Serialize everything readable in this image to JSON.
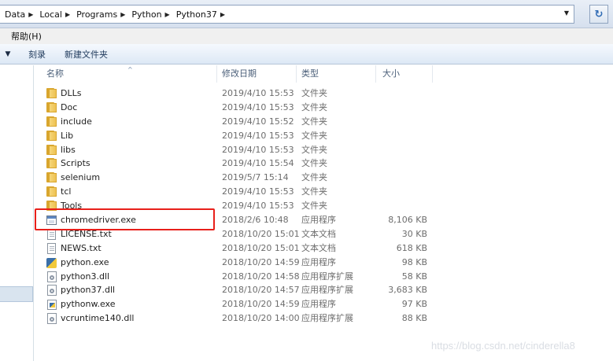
{
  "address_bar": {
    "breadcrumbs": [
      "Data",
      "Local",
      "Programs",
      "Python",
      "Python37"
    ],
    "separator_icon": "chevron-right-icon",
    "dropdown_icon": "chevron-down-icon",
    "refresh_icon": "refresh-icon"
  },
  "menu": {
    "items": [
      "帮助(H)"
    ]
  },
  "toolbar": {
    "dropdown_icon": "chevron-down-icon",
    "buttons": [
      "刻录",
      "新建文件夹"
    ]
  },
  "columns": [
    "名称",
    "修改日期",
    "类型",
    "大小"
  ],
  "files": [
    {
      "name": "DLLs",
      "date": "2019/4/10 15:53",
      "type": "文件夹",
      "size": "",
      "icon": "folder-icon"
    },
    {
      "name": "Doc",
      "date": "2019/4/10 15:53",
      "type": "文件夹",
      "size": "",
      "icon": "folder-icon"
    },
    {
      "name": "include",
      "date": "2019/4/10 15:52",
      "type": "文件夹",
      "size": "",
      "icon": "folder-icon"
    },
    {
      "name": "Lib",
      "date": "2019/4/10 15:53",
      "type": "文件夹",
      "size": "",
      "icon": "folder-icon"
    },
    {
      "name": "libs",
      "date": "2019/4/10 15:53",
      "type": "文件夹",
      "size": "",
      "icon": "folder-icon"
    },
    {
      "name": "Scripts",
      "date": "2019/4/10 15:54",
      "type": "文件夹",
      "size": "",
      "icon": "folder-icon"
    },
    {
      "name": "selenium",
      "date": "2019/5/7 15:14",
      "type": "文件夹",
      "size": "",
      "icon": "folder-icon"
    },
    {
      "name": "tcl",
      "date": "2019/4/10 15:53",
      "type": "文件夹",
      "size": "",
      "icon": "folder-icon"
    },
    {
      "name": "Tools",
      "date": "2019/4/10 15:53",
      "type": "文件夹",
      "size": "",
      "icon": "folder-icon"
    },
    {
      "name": "chromedriver.exe",
      "date": "2018/2/6 10:48",
      "type": "应用程序",
      "size": "8,106 KB",
      "icon": "exe-icon"
    },
    {
      "name": "LICENSE.txt",
      "date": "2018/10/20 15:01",
      "type": "文本文档",
      "size": "30 KB",
      "icon": "text-file-icon"
    },
    {
      "name": "NEWS.txt",
      "date": "2018/10/20 15:01",
      "type": "文本文档",
      "size": "618 KB",
      "icon": "text-file-icon"
    },
    {
      "name": "python.exe",
      "date": "2018/10/20 14:59",
      "type": "应用程序",
      "size": "98 KB",
      "icon": "python-icon"
    },
    {
      "name": "python3.dll",
      "date": "2018/10/20 14:58",
      "type": "应用程序扩展",
      "size": "58 KB",
      "icon": "dll-icon"
    },
    {
      "name": "python37.dll",
      "date": "2018/10/20 14:57",
      "type": "应用程序扩展",
      "size": "3,683 KB",
      "icon": "dll-icon"
    },
    {
      "name": "pythonw.exe",
      "date": "2018/10/20 14:59",
      "type": "应用程序",
      "size": "97 KB",
      "icon": "pythonw-icon"
    },
    {
      "name": "vcruntime140.dll",
      "date": "2018/10/20 14:00",
      "type": "应用程序扩展",
      "size": "88 KB",
      "icon": "dll-icon"
    }
  ],
  "highlighted_file": "chromedriver.exe",
  "highlight_color": "#e8201b",
  "watermark": "https://blog.csdn.net/cinderella8"
}
